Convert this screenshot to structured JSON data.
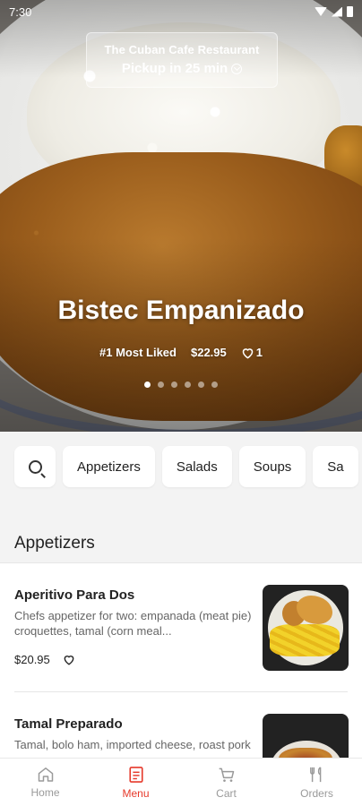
{
  "status_bar": {
    "time": "7:30"
  },
  "hero": {
    "restaurant_name": "The Cuban Cafe Restaurant",
    "pickup_text": "Pickup in 25 min",
    "dish_name": "Bistec Empanizado",
    "badge": "#1 Most Liked",
    "price": "$22.95",
    "likes": "1",
    "carousel": {
      "total_slides": 6,
      "active_slide": 1
    }
  },
  "categories": {
    "items": [
      "Appetizers",
      "Salads",
      "Soups",
      "Sa"
    ]
  },
  "section": {
    "title": "Appetizers"
  },
  "menu_items": [
    {
      "name": "Aperitivo Para Dos",
      "description": "Chefs appetizer for two: empanada (meat pie) croquettes, tamal (corn meal...",
      "price": "$20.95"
    },
    {
      "name": "Tamal Preparado",
      "description": "Tamal, bolo ham, imported cheese, roast pork"
    }
  ],
  "bottom_nav": {
    "items": [
      {
        "label": "Home",
        "icon": "home-icon"
      },
      {
        "label": "Menu",
        "icon": "menu-icon"
      },
      {
        "label": "Cart",
        "icon": "cart-icon"
      },
      {
        "label": "Orders",
        "icon": "orders-icon"
      }
    ],
    "active": "Menu",
    "active_color": "#e6392a",
    "inactive_color": "#9a9a9a"
  }
}
